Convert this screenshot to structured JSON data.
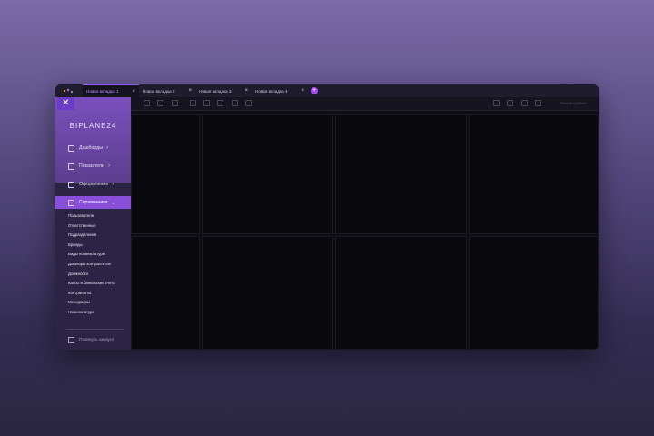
{
  "tabs": [
    {
      "label": "Новая вкладка 1",
      "active": true
    },
    {
      "label": "Новая вкладка 2",
      "active": false
    },
    {
      "label": "Новая вкладка 3",
      "active": false
    },
    {
      "label": "Новая вкладка 4",
      "active": false
    }
  ],
  "tab_add_label": "+",
  "toolbar": {
    "right_text": "Режим правки"
  },
  "sidebar": {
    "brand": "BIPLANE24",
    "menu": [
      {
        "label": "Дашборды",
        "icon": "dashboard-icon"
      },
      {
        "label": "Показатели",
        "icon": "sliders-icon"
      },
      {
        "label": "Оформление",
        "icon": "edit-icon"
      },
      {
        "label": "Справочники",
        "icon": "book-icon",
        "active": true
      }
    ],
    "subitems": [
      "Пользователи",
      "Ответственные",
      "Подразделения",
      "Бренды",
      "Виды номенклатуры",
      "Договоры контрагентов",
      "Должности",
      "Кассы и банковские счета",
      "Контрагенты",
      "Менеджеры",
      "Номенклатура"
    ],
    "logout": "Покинуть аккаунт"
  },
  "colors": {
    "accent": "#8a4fd8",
    "tab_active_text": "#b88bff",
    "add_button": "#a24bf2"
  }
}
